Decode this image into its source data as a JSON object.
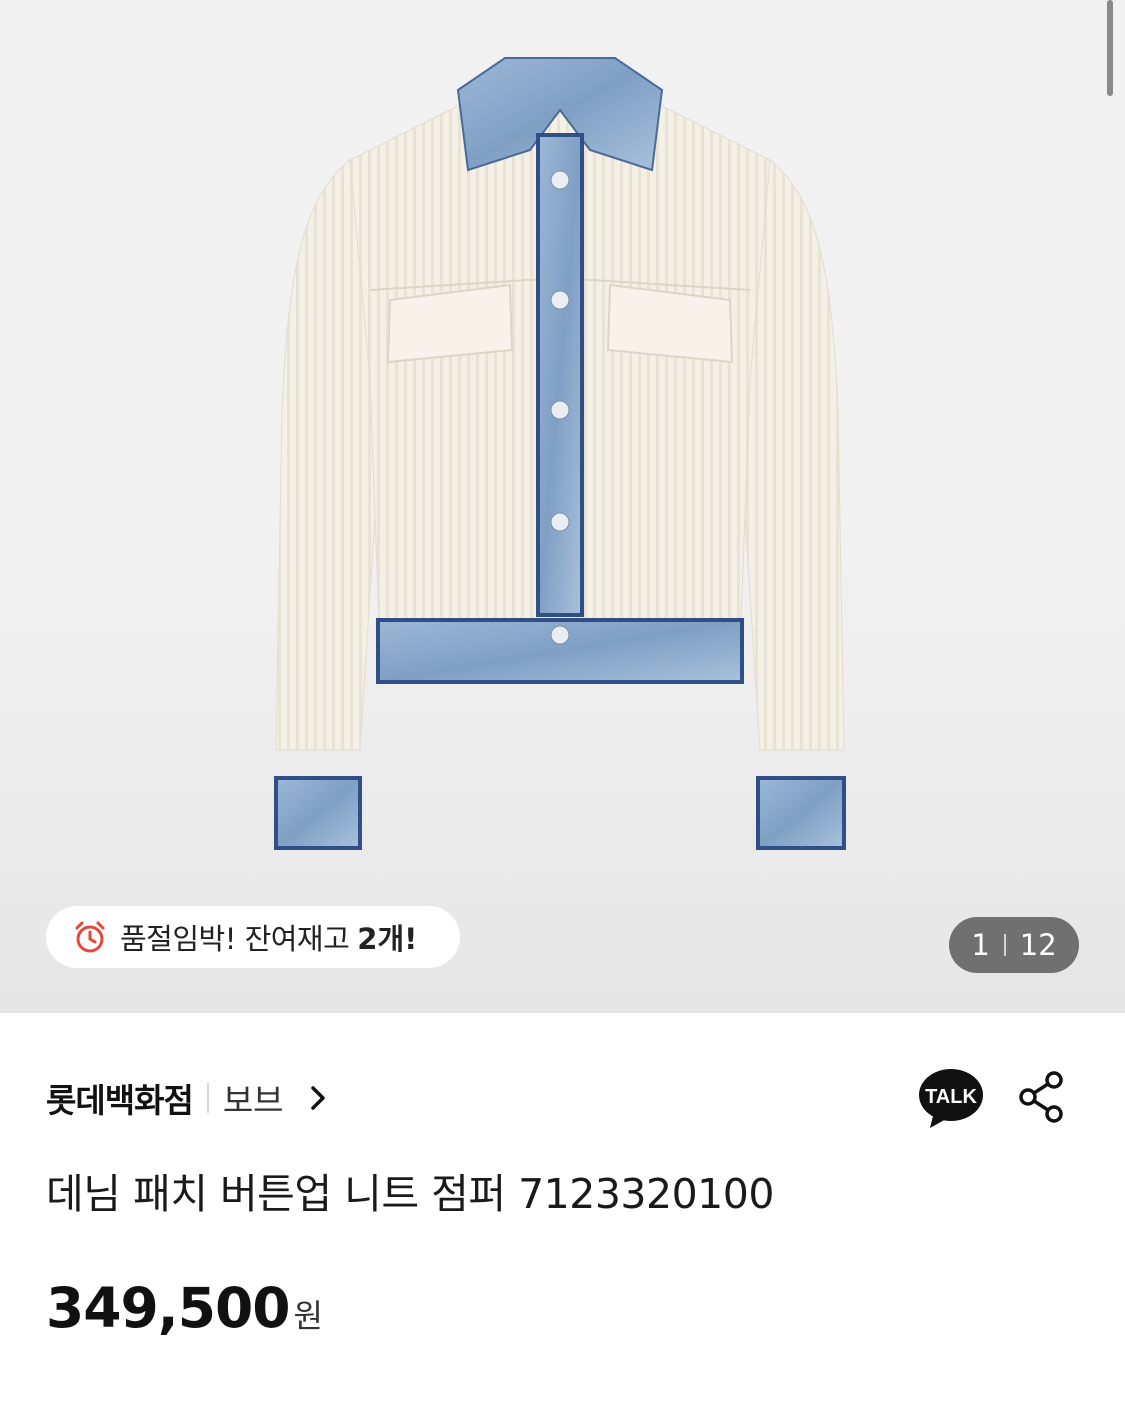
{
  "gallery": {
    "stock_message": "품절임박! 잔여재고",
    "stock_count": "2개!",
    "current_index": "1",
    "total_images": "12"
  },
  "product": {
    "store": "롯데백화점",
    "brand": "보브",
    "title": "데님 패치 버튼업 니트 점퍼 7123320100",
    "price": "349,500",
    "currency": "원"
  },
  "actions": {
    "talk_label": "TALK"
  },
  "icons": {
    "alarm": "alarm-clock-icon",
    "chevron": "chevron-right-icon",
    "talk": "kakaotalk-icon",
    "share": "share-icon"
  },
  "colors": {
    "accent_red": "#e8453c",
    "text_dark": "#111111",
    "counter_bg": "#5a5a5a"
  }
}
